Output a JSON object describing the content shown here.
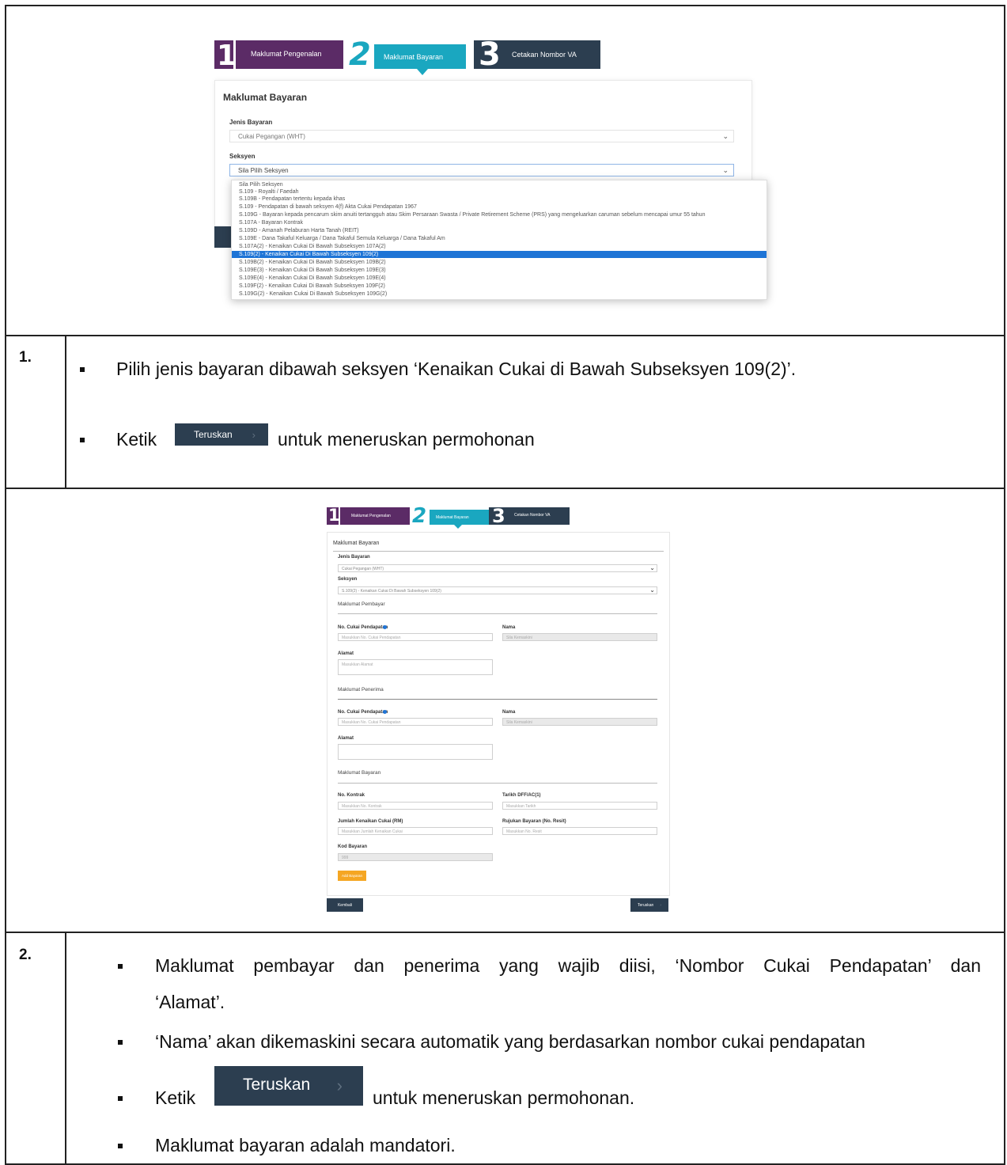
{
  "screenshot1": {
    "steps": [
      {
        "num": "1",
        "label": "Maklumat Pengenalan",
        "color": "#5b2b66"
      },
      {
        "num": "2",
        "label": "Maklumat Bayaran",
        "color": "#1aa7c0"
      },
      {
        "num": "3",
        "label": "Cetakan Nombor VA",
        "color": "#2c3e50"
      }
    ],
    "card_title": "Maklumat Bayaran",
    "jenis_label": "Jenis Bayaran",
    "jenis_value": "Cukai Pegangan (WHT)",
    "seksyen_label": "Seksyen",
    "seksyen_value": "Sila Pilih Seksyen",
    "options": [
      "Sila Pilih Seksyen",
      "S.109 - Royalti / Faedah",
      "S.109B - Pendapatan tertentu kepada khas",
      "S.109 - Pendapatan di bawah seksyen 4(f) Akta Cukai Pendapatan 1967",
      "S.109G - Bayaran kepada pencarum skim anuiti tertangguh atau Skim Persaraan Swasta / Private Retirement Scheme (PRS) yang mengeluarkan caruman sebelum mencapai umur 55 tahun",
      "S.107A - Bayaran Kontrak",
      "S.109D - Amanah Pelaburan Harta Tanah (REIT)",
      "S.109E - Dana Takaful Keluarga / Dana Takaful Semula Keluarga / Dana Takaful Am",
      "S.107A(2) - Kenaikan Cukai Di Bawah Subseksyen 107A(2)",
      "S.109(2) - Kenaikan Cukai Di Bawah Subseksyen 109(2)",
      "S.109B(2) - Kenaikan Cukai Di Bawah Subseksyen 109B(2)",
      "S.109E(3) - Kenaikan Cukai Di Bawah Subseksyen 109E(3)",
      "S.109E(4) - Kenaikan Cukai Di Bawah Subseksyen 109E(4)",
      "S.109F(2) - Kenaikan Cukai Di Bawah Subseksyen 109F(2)",
      "S.109G(2) - Kenaikan Cukai Di Bawah Subseksyen 109G(2)"
    ]
  },
  "row1": {
    "number": "1.",
    "bullet1": "Pilih jenis bayaran dibawah seksyen ‘Kenaikan Cukai di Bawah Subseksyen 109(2)’.",
    "bullet2_prefix": "Ketik",
    "button_label": "Teruskan",
    "bullet2_suffix": "untuk meneruskan permohonan"
  },
  "screenshot2": {
    "steps": [
      {
        "num": "1",
        "label": "Maklumat Pengenalan"
      },
      {
        "num": "2",
        "label": "Maklumat Bayaran"
      },
      {
        "num": "3",
        "label": "Cetakan Nombor VA"
      }
    ],
    "card_title": "Maklumat Bayaran",
    "jenis_label": "Jenis Bayaran",
    "jenis_value": "Cukai Pegangan (WHT)",
    "seksyen_label": "Seksyen",
    "seksyen_value": "S.109(2) - Kenaikan Cukai Di Bawah Subseksyen 109(2)",
    "pembayar_title": "Maklumat Pembayar",
    "penerima_title": "Maklumat Penerima",
    "bayaran_title": "Maklumat Bayaran",
    "no_cukai_label": "No. Cukai Pendapatan",
    "nama_label": "Nama",
    "alamat_label": "Alamat",
    "no_cukai_ph": "Masukkan No. Cukai Pendapatan",
    "nama_ph": "Sila Kemaskini",
    "alamat_ph": "Masukkan Alamat",
    "no_kontrak_label": "No. Kontrak",
    "tarikh_label": "Tarikh DFF/AC(1)",
    "no_kontrak_ph": "Masukkan No. Kontrak",
    "tarikh_ph": "Masukkan Tarikh",
    "jumlah_label": "Jumlah Kenaikan Cukai (RM)",
    "rujukan_label": "Rujukan Bayaran (No. Resit)",
    "jumlah_ph": "Masukkan Jumlah Kenaikan Cukai",
    "rujukan_ph": "Masukkan No. Resit",
    "kod_label": "Kod Bayaran",
    "kod_value": "999",
    "add_button": "Add Bayaran",
    "back_button": "Kembali",
    "next_button": "Teruskan"
  },
  "row2": {
    "number": "2.",
    "bullet1_line1": "Maklumat pembayar dan penerima yang wajib diisi, ‘Nombor Cukai Pendapatan’ dan",
    "bullet1_line2": "‘Alamat’.",
    "bullet2": "‘Nama’ akan dikemaskini secara automatik yang berdasarkan nombor cukai pendapatan",
    "bullet3_prefix": "Ketik",
    "button_label": "Teruskan",
    "bullet3_suffix": "untuk meneruskan permohonan.",
    "bullet4": "Maklumat bayaran adalah mandatori."
  },
  "colors": {
    "purple": "#5b2b66",
    "teal": "#1aa7c0",
    "navy": "#2c3e50",
    "highlight": "#1e74d6",
    "orange": "#f5a623"
  }
}
